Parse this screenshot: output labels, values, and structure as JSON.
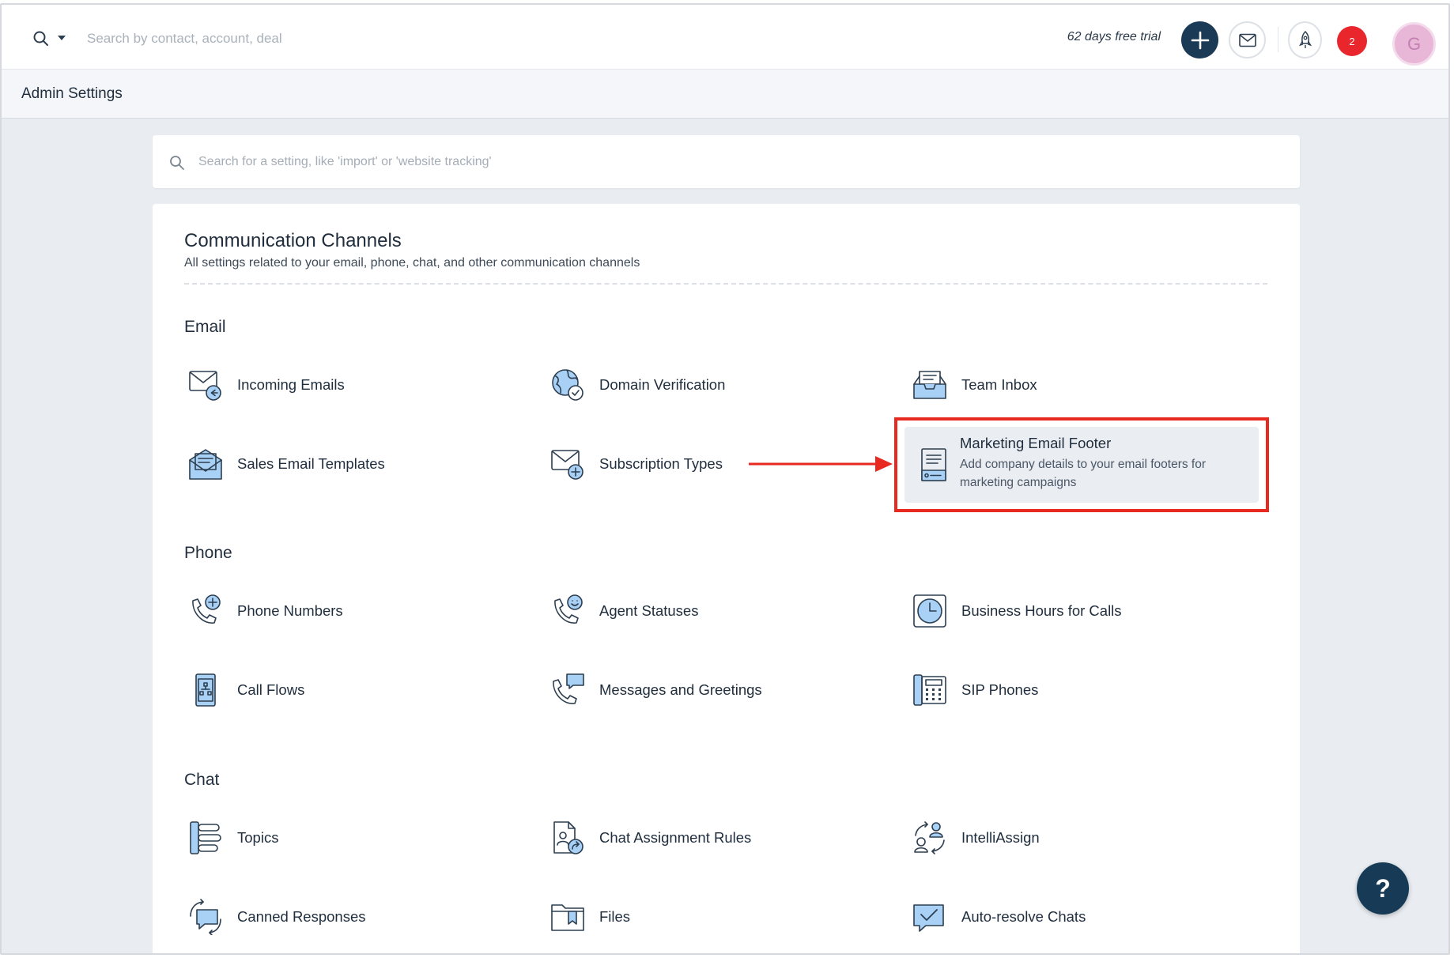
{
  "topbar": {
    "search_placeholder": "Search by contact, account, deal",
    "trial_text": "62 days free trial",
    "notification_count": "2",
    "avatar_initial": "G"
  },
  "subheader": {
    "title": "Admin Settings"
  },
  "settings_search": {
    "placeholder": "Search for a setting, like 'import' or 'website tracking'"
  },
  "card": {
    "title": "Communication Channels",
    "description": "All settings related to your email, phone, chat, and other communication channels"
  },
  "sections": {
    "email": {
      "title": "Email",
      "items": [
        {
          "label": "Incoming Emails",
          "icon": "incoming-email-icon"
        },
        {
          "label": "Domain Verification",
          "icon": "globe-check-icon"
        },
        {
          "label": "Team Inbox",
          "icon": "inbox-tray-icon"
        },
        {
          "label": "Sales Email Templates",
          "icon": "email-template-icon"
        },
        {
          "label": "Subscription Types",
          "icon": "email-plus-icon"
        }
      ],
      "highlight": {
        "title": "Marketing Email Footer",
        "description": "Add company details to your email footers for marketing campaigns",
        "icon": "document-footer-icon"
      }
    },
    "phone": {
      "title": "Phone",
      "items": [
        {
          "label": "Phone Numbers",
          "icon": "phone-plus-icon"
        },
        {
          "label": "Agent Statuses",
          "icon": "phone-smiley-icon"
        },
        {
          "label": "Business Hours for Calls",
          "icon": "clock-icon"
        },
        {
          "label": "Call Flows",
          "icon": "call-flow-icon"
        },
        {
          "label": "Messages and Greetings",
          "icon": "phone-message-icon"
        },
        {
          "label": "SIP Phones",
          "icon": "desk-phone-icon"
        }
      ]
    },
    "chat": {
      "title": "Chat",
      "items": [
        {
          "label": "Topics",
          "icon": "topics-list-icon"
        },
        {
          "label": "Chat Assignment Rules",
          "icon": "assignment-document-icon"
        },
        {
          "label": "IntelliAssign",
          "icon": "users-cycle-icon"
        },
        {
          "label": "Canned Responses",
          "icon": "chat-bubble-cycle-icon"
        },
        {
          "label": "Files",
          "icon": "folder-bookmark-icon"
        },
        {
          "label": "Auto-resolve Chats",
          "icon": "chat-check-icon"
        }
      ]
    }
  },
  "colors": {
    "primary_dark": "#1b3a55",
    "icon_fill": "#a9d1f5",
    "highlight_border": "#e8291f",
    "notification": "#e8262b"
  }
}
